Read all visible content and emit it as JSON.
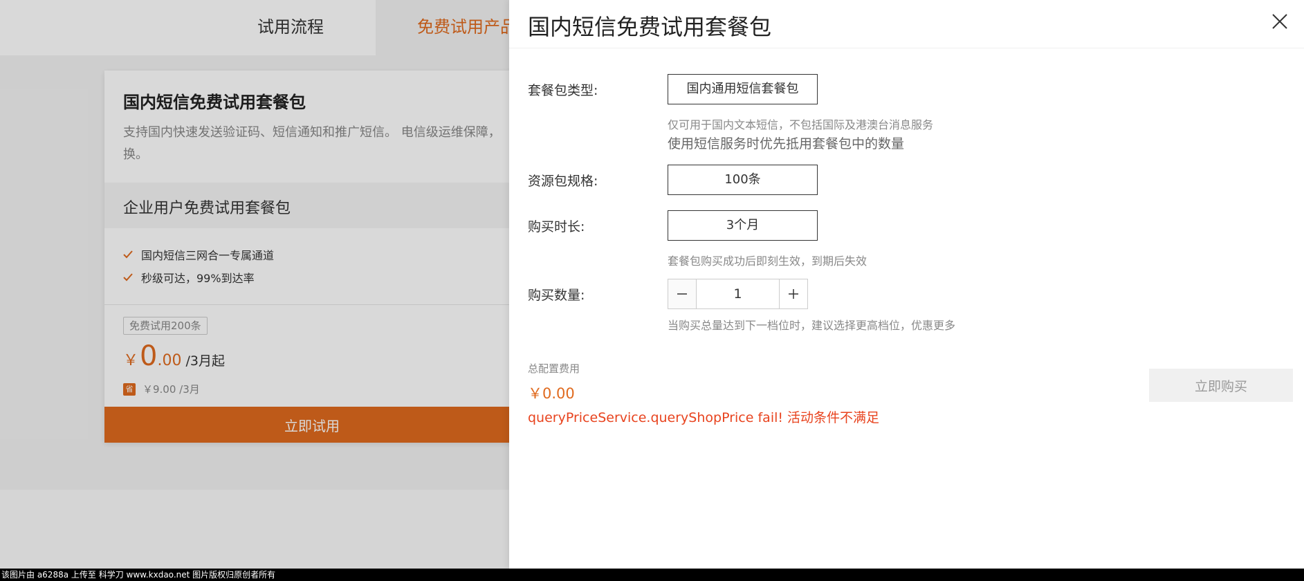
{
  "background": {
    "nav": {
      "tab_process": "试用流程",
      "tab_free": "免费试用产品"
    },
    "card": {
      "title": "国内短信免费试用套餐包",
      "description": "支持国内快速发送验证码、短信通知和推广短信。 电信级运维保障，",
      "description_cont": "换。",
      "plan_title": "企业用户免费试用套餐包",
      "features": [
        "国内短信三网合一专属通道",
        "秒级可达，99%到达率"
      ],
      "trial_badge": "免费试用200条",
      "price_symbol": "￥",
      "price_int": "0",
      "price_dec": ".00",
      "price_unit": "/3月起",
      "save_icon_text": "省",
      "orig_price": "￥9.00 /3月",
      "try_button": "立即试用"
    }
  },
  "drawer": {
    "title": "国内短信免费试用套餐包",
    "type": {
      "label": "套餐包类型:",
      "value": "国内通用短信套餐包",
      "hint1": "仅可用于国内文本短信，不包括国际及港澳台消息服务",
      "hint2": "使用短信服务时优先抵用套餐包中的数量"
    },
    "spec": {
      "label": "资源包规格:",
      "value": "100条"
    },
    "duration": {
      "label": "购买时长:",
      "value": "3个月",
      "hint": "套餐包购买成功后即刻生效，到期后失效"
    },
    "quantity": {
      "label": "购买数量:",
      "value": "1",
      "hint": "当购买总量达到下一档位时，建议选择更高档位，优惠更多"
    },
    "total": {
      "label": "总配置费用",
      "price": "￥0.00"
    },
    "error": "queryPriceService.queryShopPrice fail! 活动条件不满足",
    "buy_button": "立即购买"
  },
  "watermark": "该图片由 a6288a 上传至 科学刀 www.kxdao.net 图片版权归原创者所有",
  "colors": {
    "accent": "#e06a1e",
    "error": "#e8431e"
  },
  "icons": [
    "close-icon",
    "check-icon",
    "minus-icon",
    "plus-icon"
  ]
}
